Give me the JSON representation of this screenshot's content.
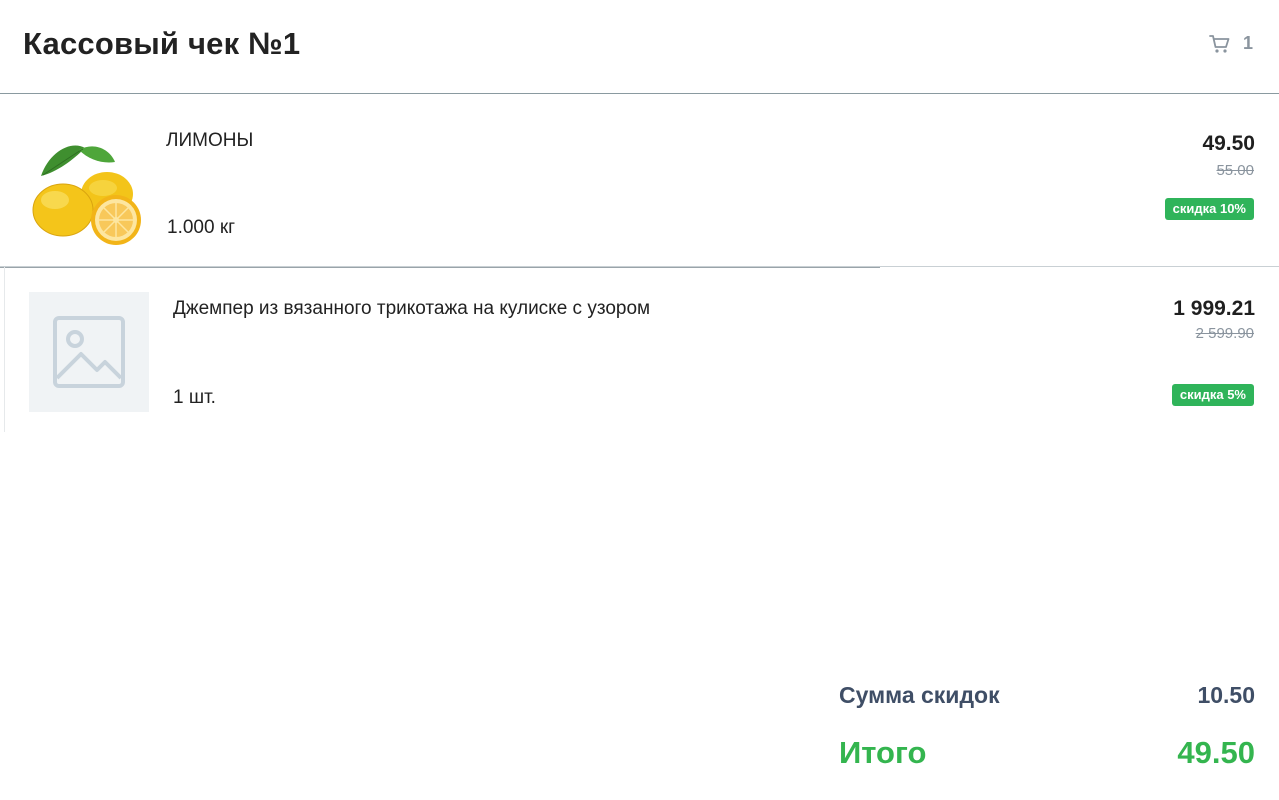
{
  "header": {
    "title": "Кассовый чек №1",
    "cart_count": "1",
    "cart_icon": "cart-icon"
  },
  "items": [
    {
      "name": "ЛИМОНЫ",
      "quantity": "1.000 кг",
      "price": "49.50",
      "old_price": "55.00",
      "discount": "скидка 10%",
      "image": "lemon-image"
    },
    {
      "name": "Джемпер из вязанного трикотажа на кулиске с узором",
      "quantity": "1 шт.",
      "price": "1 999.21",
      "old_price": "2 599.90",
      "discount": "скидка 5%",
      "image": "image-placeholder-icon"
    }
  ],
  "totals": {
    "discount_label": "Сумма скидок",
    "discount_value": "10.50",
    "total_label": "Итого",
    "total_value": "49.50"
  },
  "colors": {
    "accent_green": "#34b54f",
    "badge_green": "#2fb45a",
    "muted_gray": "#8a949e",
    "totals_label": "#3f4e66"
  }
}
